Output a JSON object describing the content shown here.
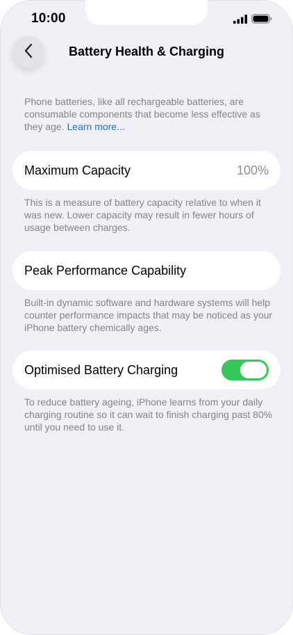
{
  "status_bar": {
    "time": "10:00"
  },
  "nav": {
    "title": "Battery Health & Charging"
  },
  "intro": {
    "text": "Phone batteries, like all rechargeable batteries, are consumable components that become less effective as they age. ",
    "link": "Learn more..."
  },
  "maximum_capacity": {
    "label": "Maximum Capacity",
    "value": "100%",
    "description": "This is a measure of battery capacity relative to when it was new. Lower capacity may result in fewer hours of usage between charges."
  },
  "peak_performance": {
    "label": "Peak Performance Capability",
    "description": "Built-in dynamic software and hardware systems will help counter performance impacts that may be noticed as your iPhone battery chemically ages."
  },
  "optimised_charging": {
    "label": "Optimised Battery Charging",
    "enabled": true,
    "description": "To reduce battery ageing, iPhone learns from your daily charging routine so it can wait to finish charging past 80% until you need to use it."
  },
  "colors": {
    "background": "#f1f0f6",
    "toggle_on": "#34c759",
    "link": "#1a73c6",
    "secondary_text": "#84838a"
  },
  "icons": {
    "back": "chevron-left-icon",
    "signal": "cellular-signal-icon",
    "battery": "battery-icon"
  }
}
